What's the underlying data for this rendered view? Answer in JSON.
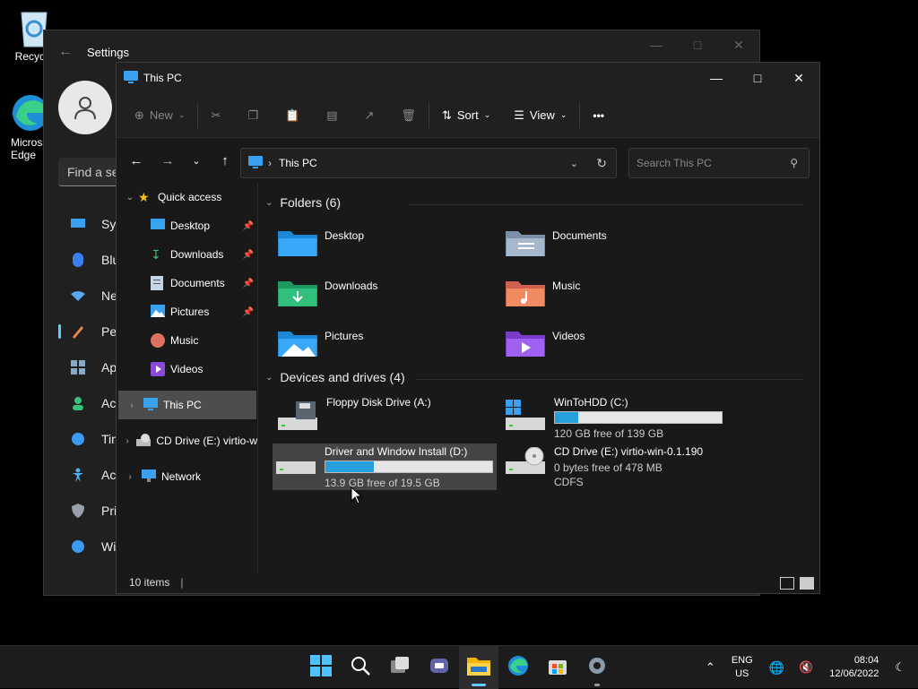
{
  "desktop": {
    "recycle_label": "Recycle",
    "edge_label_1": "Micros",
    "edge_label_2": "Edge"
  },
  "settings": {
    "title": "Settings",
    "search_placeholder": "Find a se",
    "nav": [
      "Syst",
      "Blue",
      "Net",
      "Pers",
      "App",
      "Acc",
      "Tim",
      "Acc",
      "Priv",
      "Win"
    ]
  },
  "explorer": {
    "title": "This PC",
    "toolbar": {
      "new_label": "New",
      "sort_label": "Sort",
      "view_label": "View",
      "more_label": "•••"
    },
    "address": {
      "path": "This PC",
      "search_placeholder": "Search This PC"
    },
    "sidebar": {
      "quick_access": "Quick access",
      "items": [
        "Desktop",
        "Downloads",
        "Documents",
        "Pictures",
        "Music",
        "Videos"
      ],
      "this_pc": "This PC",
      "cd_drive": "CD Drive (E:) virtio-w",
      "network": "Network"
    },
    "folders_header": "Folders (6)",
    "folders": [
      "Desktop",
      "Documents",
      "Downloads",
      "Music",
      "Pictures",
      "Videos"
    ],
    "drives_header": "Devices and drives (4)",
    "drives": {
      "floppy": {
        "name": "Floppy Disk Drive (A:)"
      },
      "c": {
        "name": "WinToHDD (C:)",
        "free": "120 GB free of 139 GB",
        "used_fraction": 0.14
      },
      "d": {
        "name": "Driver and Window Install (D:)",
        "free": "13.9 GB free of 19.5 GB",
        "used_fraction": 0.29
      },
      "e": {
        "name": "CD Drive (E:) virtio-win-0.1.190",
        "free": "0 bytes free of 478 MB",
        "fs": "CDFS"
      }
    },
    "status": "10 items"
  },
  "taskbar": {
    "lang_1": "ENG",
    "lang_2": "US",
    "time": "08:04",
    "date": "12/06/2022"
  },
  "colors": {
    "accent": "#60cdff",
    "bar_fill": "#26a0da",
    "window_bg": "#191919"
  }
}
